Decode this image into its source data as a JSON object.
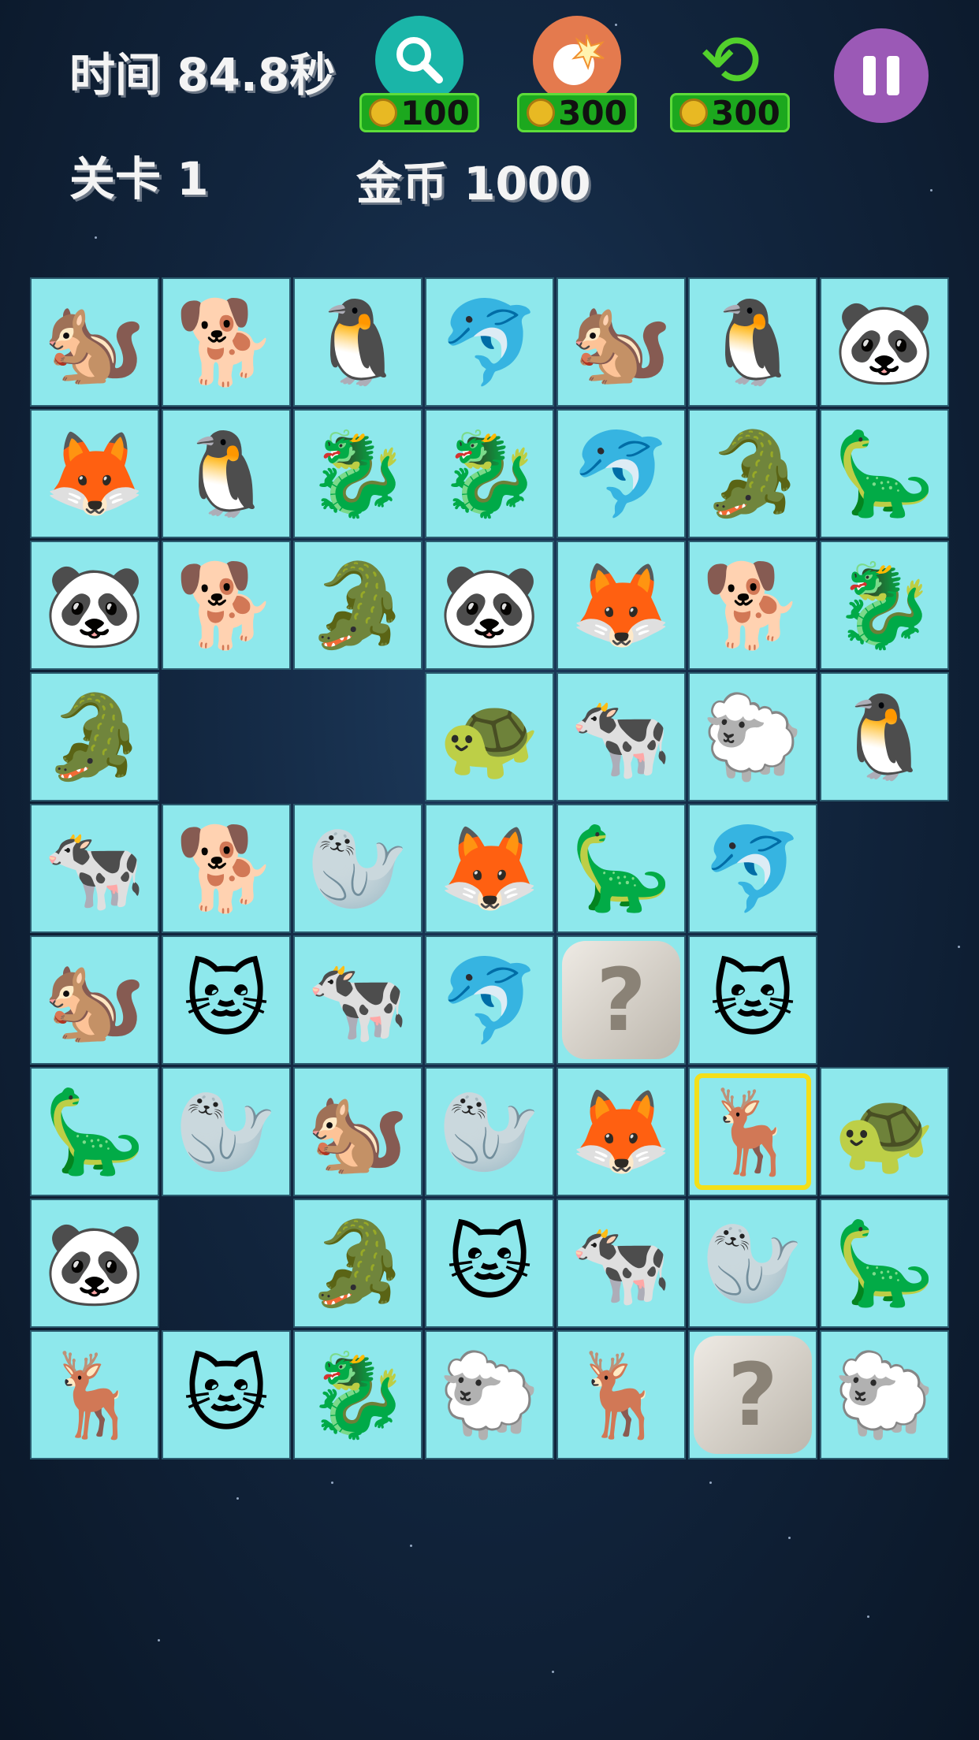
{
  "hud": {
    "time_text": "时间 84.8秒",
    "level_text": "关卡  1",
    "coins_text": "金币 1000"
  },
  "tools": {
    "hint": {
      "icon": "magnifier-icon",
      "cost": "100"
    },
    "bomb": {
      "icon": "bomb-icon",
      "cost": "300"
    },
    "shuffle": {
      "icon": "shuffle-icon",
      "cost": "300"
    }
  },
  "board": {
    "rows": [
      [
        "squirrel",
        "dog",
        "penguin",
        "dolphin",
        "squirrel",
        "penguin",
        "panda"
      ],
      [
        "fox",
        "penguin",
        "dragon",
        "dragon",
        "dolphin",
        "crocodile",
        "stegosaurus"
      ],
      [
        "panda",
        "dog",
        "crocodile",
        "panda",
        "fox",
        "dog",
        "dragon"
      ],
      [
        "crocodile",
        "",
        "",
        "turtle",
        "cow",
        "sheep",
        "penguin"
      ],
      [
        "cow",
        "dog",
        "seal",
        "fox",
        "stegosaurus",
        "dolphin",
        ""
      ],
      [
        "squirrel",
        "cat",
        "cow",
        "dolphin",
        "mystery",
        "cat",
        ""
      ],
      [
        "stegosaurus",
        "seal",
        "squirrel",
        "seal",
        "fox",
        "reindeer",
        "turtle"
      ],
      [
        "panda",
        "",
        "crocodile",
        "cat",
        "cow",
        "seal",
        "stegosaurus"
      ],
      [
        "reindeer",
        "cat",
        "dragon",
        "sheep",
        "reindeer",
        "mystery",
        "sheep"
      ]
    ],
    "selected": {
      "row": 6,
      "col": 5
    },
    "glyphs": {
      "squirrel": "🐿️",
      "dog": "🐕",
      "penguin": "🐧",
      "dolphin": "🐬",
      "panda": "🐼",
      "fox": "🦊",
      "dragon": "🐉",
      "crocodile": "🐊",
      "stegosaurus": "🦕",
      "turtle": "🐢",
      "cow": "🐄",
      "sheep": "🐑",
      "seal": "🦭",
      "cat": "🐱",
      "reindeer": "🦌",
      "mystery": "?"
    }
  }
}
